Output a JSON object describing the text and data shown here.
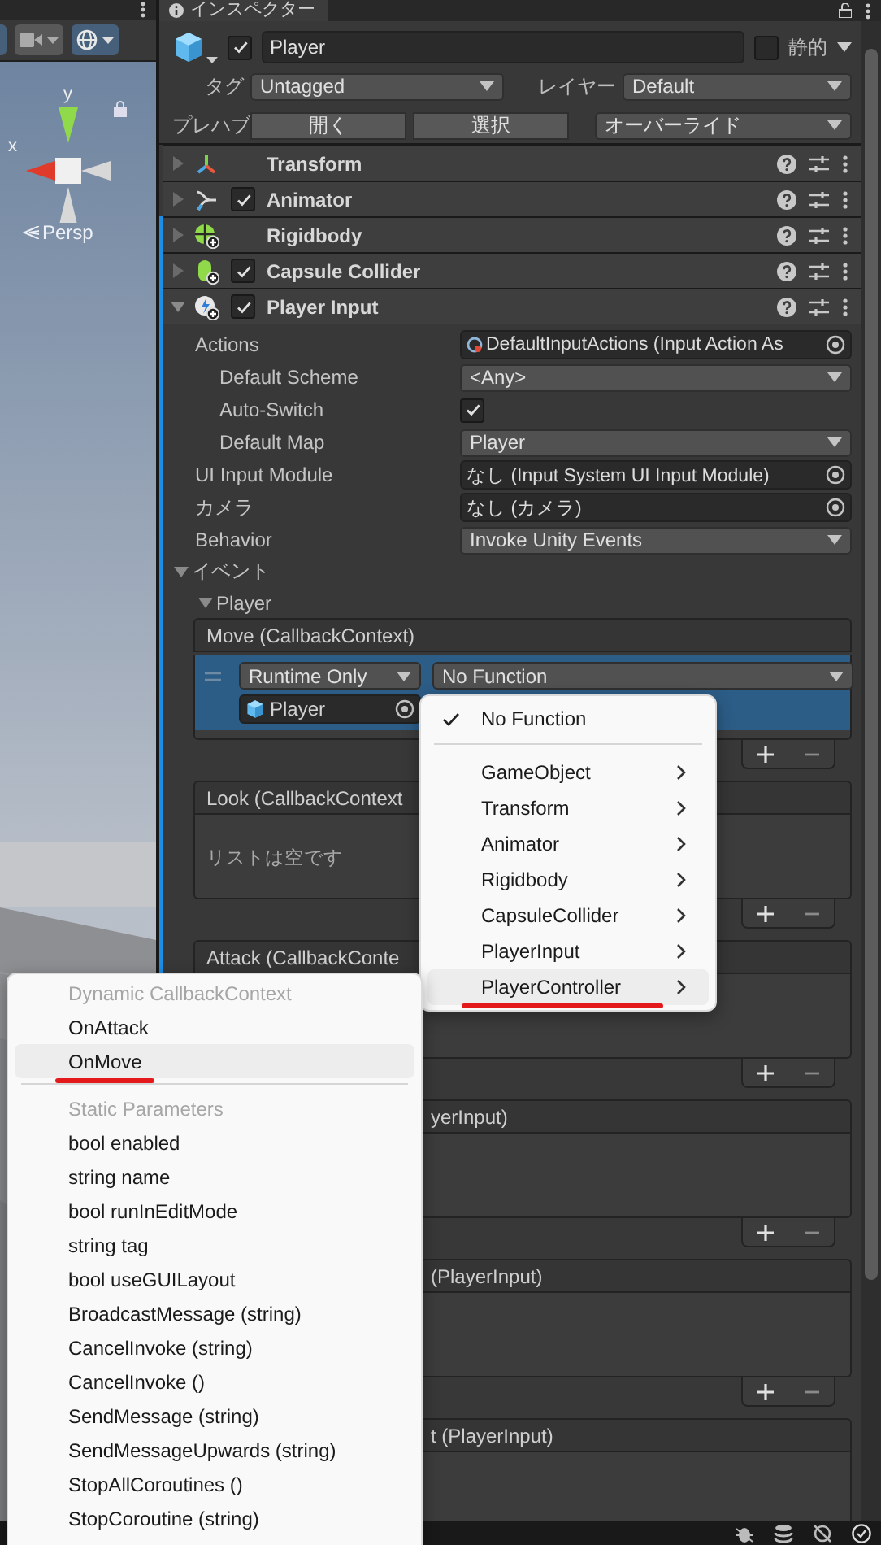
{
  "scene": {
    "axis_labels": [
      "y",
      "x"
    ],
    "projection": "Persp"
  },
  "inspector": {
    "tab": "インスペクター",
    "object": {
      "active": true,
      "name": "Player",
      "static": false,
      "static_label": "静的",
      "tag_label": "タグ",
      "tag": "Untagged",
      "layer_label": "レイヤー",
      "layer": "Default",
      "prefab_label": "プレハブ",
      "prefab_buttons": [
        "開く",
        "選択"
      ],
      "overrides": "オーバーライド"
    },
    "components": [
      {
        "name": "Transform",
        "kind": "transform",
        "expanded": false,
        "overridden": false
      },
      {
        "name": "Animator",
        "kind": "animator",
        "enabled": true,
        "expanded": false,
        "overridden": false
      },
      {
        "name": "Rigidbody",
        "kind": "rigidbody",
        "expanded": false,
        "overridden": true
      },
      {
        "name": "Capsule Collider",
        "kind": "collider",
        "enabled": true,
        "expanded": false,
        "overridden": true
      },
      {
        "name": "Player Input",
        "kind": "input",
        "enabled": true,
        "expanded": true,
        "overridden": true,
        "properties": [
          {
            "label": "Actions",
            "kind": "asset",
            "value": "DefaultInputActions (Input Action As",
            "children": [
              {
                "label": "Default Scheme",
                "kind": "dropdown",
                "value": "<Any>"
              },
              {
                "label": "Auto-Switch",
                "kind": "checkbox",
                "checked": true
              },
              {
                "label": "Default Map",
                "kind": "dropdown",
                "value": "Player"
              }
            ]
          },
          {
            "label": "UI Input Module",
            "kind": "object",
            "value": "なし (Input System UI Input Module)"
          },
          {
            "label": "カメラ",
            "kind": "object",
            "value": "なし (カメラ)"
          },
          {
            "label": "Behavior",
            "kind": "dropdown",
            "value": "Invoke Unity Events"
          }
        ],
        "events": {
          "label": "イベント",
          "expanded": true,
          "maps": [
            {
              "label": "Player",
              "expanded": true,
              "sections": [
                {
                  "title": "Move (CallbackContext)",
                  "kind": "full",
                  "has_footer": true,
                  "listeners": [
                    {
                      "mode": "Runtime Only",
                      "function": "No Function",
                      "target": "Player"
                    }
                  ]
                },
                {
                  "title": "Look (CallbackContext",
                  "kind": "full",
                  "has_footer": true,
                  "empty_text": "リストは空です"
                },
                {
                  "title": "Attack (CallbackConte",
                  "kind": "full",
                  "has_footer": true
                },
                {
                  "title": "yerInput)",
                  "kind": "covered",
                  "has_footer": true
                },
                {
                  "title": "(PlayerInput)",
                  "kind": "covered",
                  "has_footer": true
                },
                {
                  "title": "t (PlayerInput)",
                  "kind": "covered",
                  "has_footer": false
                }
              ]
            }
          ]
        }
      }
    ]
  },
  "function_menu": {
    "items": [
      {
        "kind": "item",
        "label": "No Function",
        "checked": true,
        "selected": false
      },
      {
        "kind": "separator"
      },
      {
        "kind": "submenu",
        "label": "GameObject",
        "checked": false,
        "selected": false
      },
      {
        "kind": "submenu",
        "label": "Transform",
        "checked": false,
        "selected": false
      },
      {
        "kind": "submenu",
        "label": "Animator",
        "checked": false,
        "selected": false
      },
      {
        "kind": "submenu",
        "label": "Rigidbody",
        "checked": false,
        "selected": false
      },
      {
        "kind": "submenu",
        "label": "CapsuleCollider",
        "checked": false,
        "selected": false
      },
      {
        "kind": "submenu",
        "label": "PlayerInput",
        "checked": false,
        "selected": false
      },
      {
        "kind": "submenu",
        "label": "PlayerController",
        "checked": false,
        "selected": true
      }
    ]
  },
  "method_menu": {
    "items": [
      {
        "kind": "heading",
        "label": "Dynamic CallbackContext"
      },
      {
        "kind": "item",
        "label": "OnAttack",
        "selected": false
      },
      {
        "kind": "item",
        "label": "OnMove",
        "selected": true
      },
      {
        "kind": "separator"
      },
      {
        "kind": "heading",
        "label": "Static Parameters"
      },
      {
        "kind": "item",
        "label": "bool enabled",
        "selected": false
      },
      {
        "kind": "item",
        "label": "string name",
        "selected": false
      },
      {
        "kind": "item",
        "label": "bool runInEditMode",
        "selected": false
      },
      {
        "kind": "item",
        "label": "string tag",
        "selected": false
      },
      {
        "kind": "item",
        "label": "bool useGUILayout",
        "selected": false
      },
      {
        "kind": "item",
        "label": "BroadcastMessage (string)",
        "selected": false
      },
      {
        "kind": "item",
        "label": "CancelInvoke (string)",
        "selected": false
      },
      {
        "kind": "item",
        "label": "CancelInvoke ()",
        "selected": false
      },
      {
        "kind": "item",
        "label": "SendMessage (string)",
        "selected": false
      },
      {
        "kind": "item",
        "label": "SendMessageUpwards (string)",
        "selected": false
      },
      {
        "kind": "item",
        "label": "StopAllCoroutines ()",
        "selected": false
      },
      {
        "kind": "item",
        "label": "StopCoroutine (string)",
        "selected": false
      }
    ]
  }
}
